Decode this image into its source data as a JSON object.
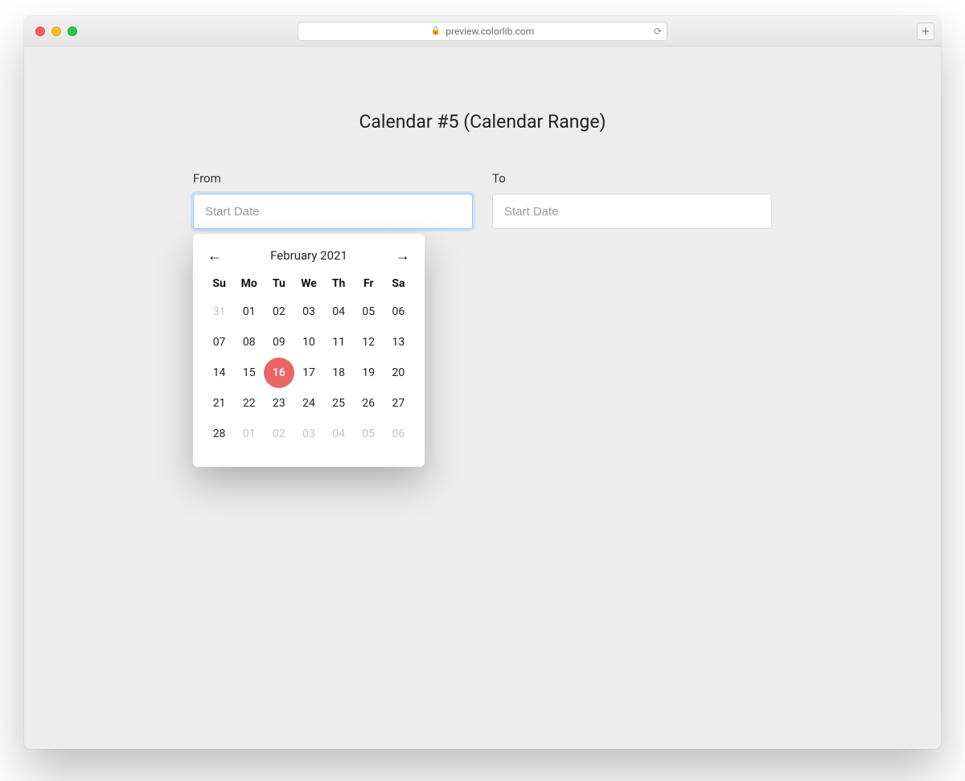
{
  "browser": {
    "url": "preview.colorlib.com"
  },
  "page": {
    "title": "Calendar #5 (Calendar Range)"
  },
  "form": {
    "from": {
      "label": "From",
      "placeholder": "Start Date",
      "value": ""
    },
    "to": {
      "label": "To",
      "placeholder": "Start Date",
      "value": ""
    }
  },
  "datepicker": {
    "month_label": "February 2021",
    "dows": [
      "Su",
      "Mo",
      "Tu",
      "We",
      "Th",
      "Fr",
      "Sa"
    ],
    "weeks": [
      [
        {
          "d": "31",
          "other": true
        },
        {
          "d": "01"
        },
        {
          "d": "02"
        },
        {
          "d": "03"
        },
        {
          "d": "04"
        },
        {
          "d": "05"
        },
        {
          "d": "06"
        }
      ],
      [
        {
          "d": "07"
        },
        {
          "d": "08"
        },
        {
          "d": "09"
        },
        {
          "d": "10"
        },
        {
          "d": "11"
        },
        {
          "d": "12"
        },
        {
          "d": "13"
        }
      ],
      [
        {
          "d": "14"
        },
        {
          "d": "15"
        },
        {
          "d": "16",
          "selected": true
        },
        {
          "d": "17"
        },
        {
          "d": "18"
        },
        {
          "d": "19"
        },
        {
          "d": "20"
        }
      ],
      [
        {
          "d": "21"
        },
        {
          "d": "22"
        },
        {
          "d": "23"
        },
        {
          "d": "24"
        },
        {
          "d": "25"
        },
        {
          "d": "26"
        },
        {
          "d": "27"
        }
      ],
      [
        {
          "d": "28"
        },
        {
          "d": "01",
          "other": true
        },
        {
          "d": "02",
          "other": true
        },
        {
          "d": "03",
          "other": true
        },
        {
          "d": "04",
          "other": true
        },
        {
          "d": "05",
          "other": true
        },
        {
          "d": "06",
          "other": true
        }
      ]
    ],
    "colors": {
      "accent": "#ea6666"
    }
  }
}
